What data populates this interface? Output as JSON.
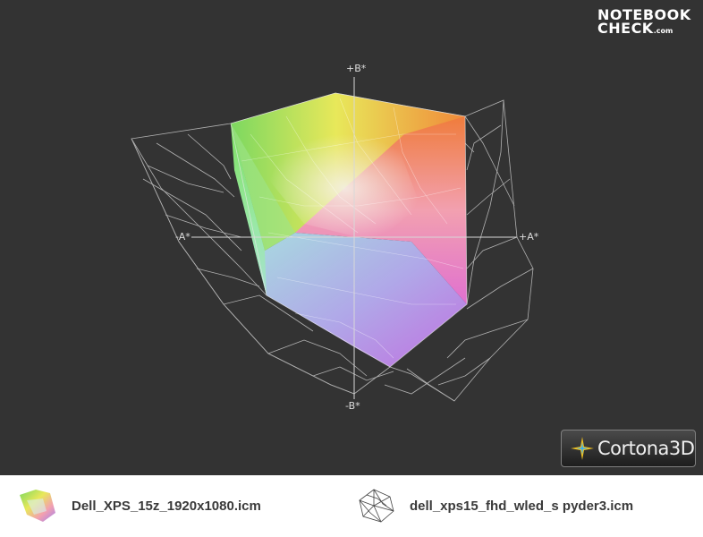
{
  "brand": {
    "line1": "NOTEBOOK",
    "line2": "CHECK",
    "suffix": ".com"
  },
  "axes": {
    "b_plus": "+B*",
    "b_minus": "-B*",
    "a_plus": "+A*",
    "a_minus": "-A*"
  },
  "player": {
    "logo_text": "Cortona3D"
  },
  "legend": {
    "items": [
      {
        "label": "Dell_XPS_15z_1920x1080.icm",
        "icon": "color-gamut-solid-icon"
      },
      {
        "label": "dell_xps15_fhd_wled_s pyder3.icm",
        "icon": "gamut-wireframe-icon"
      }
    ]
  }
}
